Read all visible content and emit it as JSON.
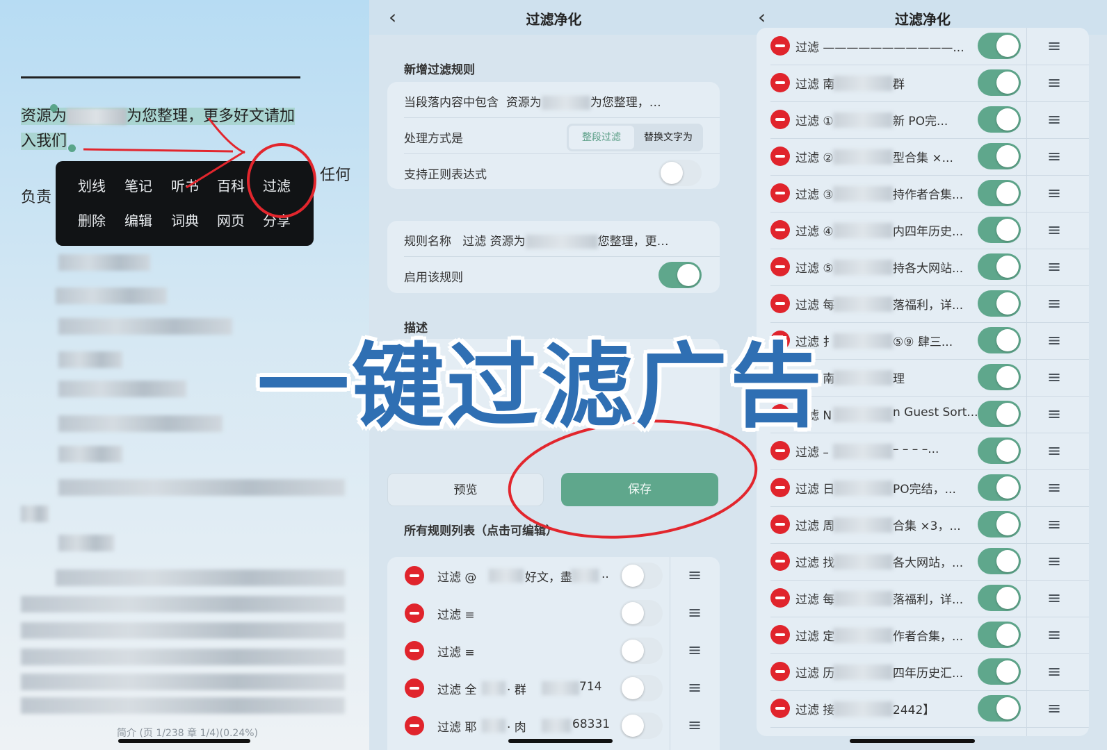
{
  "reader": {
    "para_start": "资源为",
    "para_mid": "为您整理，更多好文请加",
    "para_end": "入我们",
    "line2_start": "负责",
    "line2_end": "任何",
    "menu_row1": [
      "划线",
      "笔记",
      "听书",
      "百科",
      "过滤"
    ],
    "menu_row2": [
      "删除",
      "编辑",
      "词典",
      "网页",
      "分享"
    ],
    "page_info": "简介 (页 1/238 章 1/4)(0.24%)"
  },
  "filter_page": {
    "title": "过滤净化",
    "section_new": "新增过滤规则",
    "contains_label": "当段落内容中包含",
    "contains_value": "资源为",
    "contains_tail": "为您整理，…",
    "process_label": "处理方式是",
    "mode_options": [
      "整段过滤",
      "替换文字为"
    ],
    "mode_selected": "整段过滤",
    "regex_label": "支持正则表达式",
    "regex_enabled": false,
    "name_label": "规则名称",
    "name_value": "过滤 资源为",
    "name_tail": "您整理，更…",
    "enable_label": "启用该规则",
    "enable_on": true,
    "desc_label": "描述",
    "preview_button": "预览",
    "save_button": "保存",
    "section_all": "所有规则列表（点击可编辑）",
    "rules": [
      {
        "text": "过滤 @",
        "tail": "好文，盡",
        "tail2": "..",
        "on": false
      },
      {
        "text": "过滤 ≡",
        "tail": "",
        "tail2": "",
        "on": false
      },
      {
        "text": "过滤 ≡",
        "tail": "",
        "tail2": "",
        "on": false
      },
      {
        "text": "过滤 全",
        "tail": "· 群",
        "tail2": "714",
        "on": false
      },
      {
        "text": "过滤 耶",
        "tail": "· 肉",
        "tail2": "68331",
        "on": false
      }
    ]
  },
  "rules_page": {
    "title": "过滤净化",
    "rules": [
      {
        "left": "过滤 ———————————...",
        "right": "",
        "on": true
      },
      {
        "left": "过滤 南",
        "right": "群",
        "on": true
      },
      {
        "left": "过滤 ①",
        "right": "新 PO完...",
        "on": true
      },
      {
        "left": "过滤 ②",
        "right": "型合集 ×...",
        "on": true
      },
      {
        "left": "过滤 ③",
        "right": "持作者合集...",
        "on": true
      },
      {
        "left": "过滤 ④",
        "right": "内四年历史...",
        "on": true
      },
      {
        "left": "过滤 ⑤",
        "right": "持各大网站...",
        "on": true
      },
      {
        "left": "过滤 每",
        "right": "落福利，详...",
        "on": true
      },
      {
        "left": "过滤 扌",
        "right": "⑤⑨ 肆三...",
        "on": true
      },
      {
        "left": "过滤 南",
        "right": "理",
        "on": true
      },
      {
        "left": "过滤 N",
        "right": "n Guest Sort...",
        "on": true
      },
      {
        "left": "过滤 –",
        "right": "– – – –...",
        "on": true
      },
      {
        "left": "过滤 日",
        "right": "PO完结，...",
        "on": true
      },
      {
        "left": "过滤 周",
        "right": "合集 ×3，...",
        "on": true
      },
      {
        "left": "过滤 找",
        "right": "各大网站，...",
        "on": true
      },
      {
        "left": "过滤 每",
        "right": "落福利，详...",
        "on": true
      },
      {
        "left": "过滤 定",
        "right": "作者合集，...",
        "on": true
      },
      {
        "left": "过滤 历",
        "right": "四年历史汇...",
        "on": true
      },
      {
        "left": "过滤 接",
        "right": "2442】",
        "on": true
      }
    ]
  },
  "overlay": {
    "headline": "一键过滤广告",
    "headline_color": "#2f6fb3",
    "annotation_color": "#e2262d",
    "accent": "#5fa78c"
  }
}
